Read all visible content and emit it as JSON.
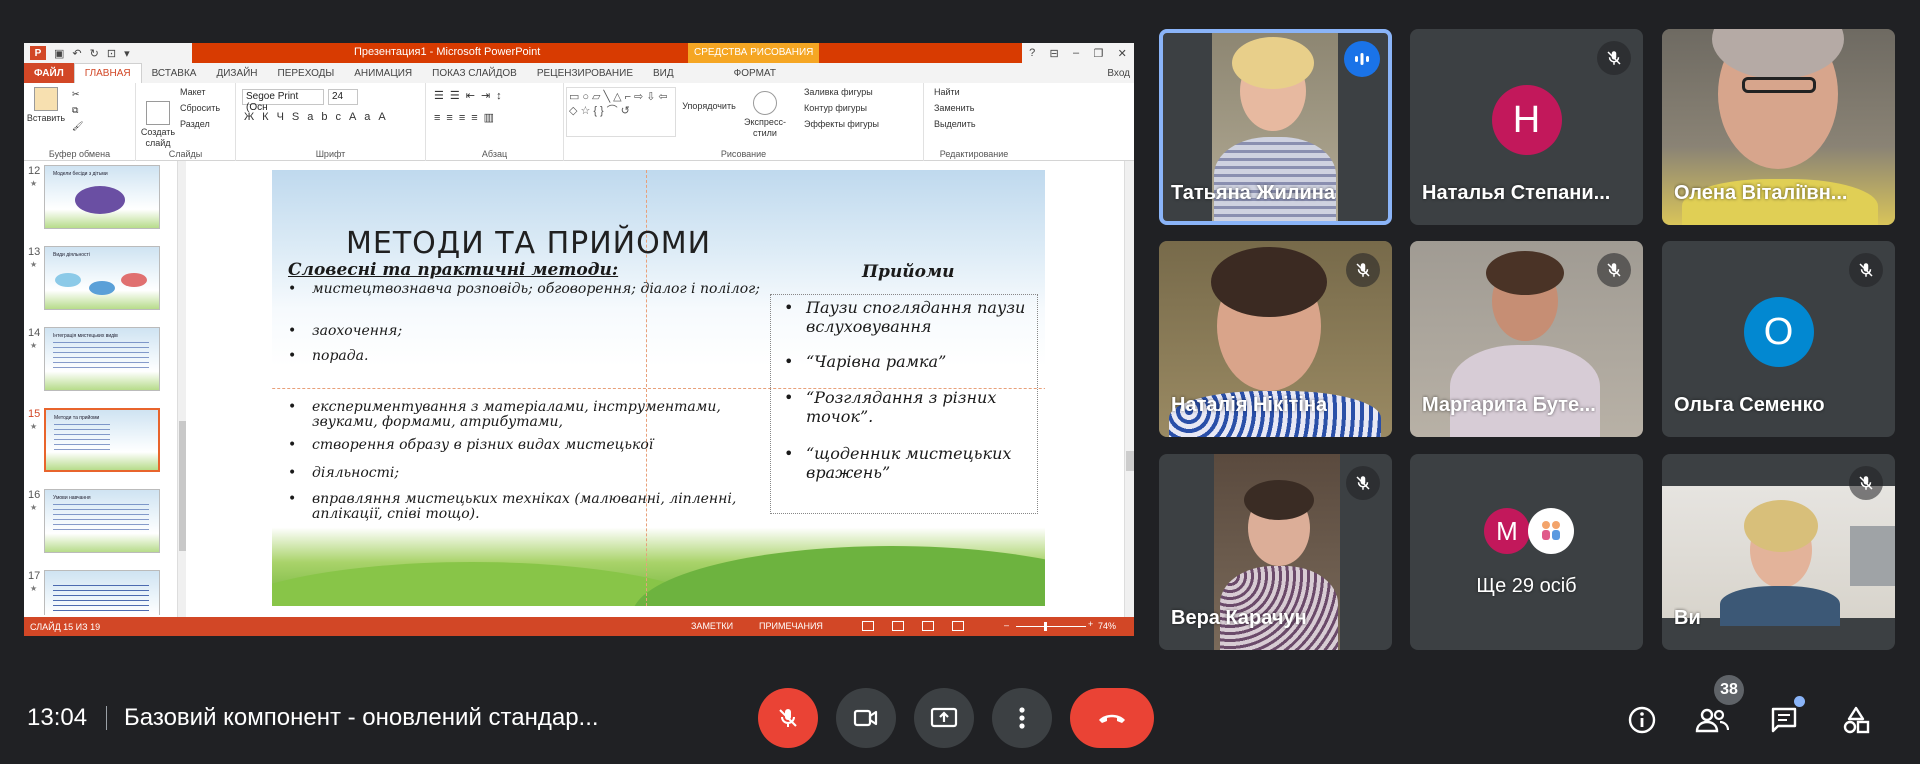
{
  "powerpoint": {
    "title": "Презентация1 - Microsoft PowerPoint",
    "context_tab": "СРЕДСТВА РИСОВАНИЯ",
    "tabs": [
      "ФАЙЛ",
      "ГЛАВНАЯ",
      "ВСТАВКА",
      "ДИЗАЙН",
      "ПЕРЕХОДЫ",
      "АНИМАЦИЯ",
      "ПОКАЗ СЛАЙДОВ",
      "РЕЦЕНЗИРОВАНИЕ",
      "ВИД",
      "ФОРМАТ"
    ],
    "signin": "Вход",
    "ribbon": {
      "paste": "Вставить",
      "clipboard_group": "Буфер обмена",
      "layout": "Макет",
      "reset": "Сбросить",
      "section": "Раздел",
      "new_slide": "Создать слайд",
      "slides_group": "Слайды",
      "font_name": "Segoe Print (Осн",
      "font_size": "24",
      "font_group": "Шрифт",
      "paragraph_group": "Абзац",
      "arrange": "Упорядочить",
      "quick_styles": "Экспресс-стили",
      "shape_fill": "Заливка фигуры",
      "shape_outline": "Контур фигуры",
      "shape_effects": "Эффекты фигуры",
      "drawing_group": "Рисование",
      "find": "Найти",
      "replace": "Заменить",
      "select": "Выделить",
      "editing_group": "Редактирование"
    },
    "thumbnails": [
      {
        "num": "12",
        "title": "Модели бесіди з дітьми"
      },
      {
        "num": "13",
        "title": "Види діяльності"
      },
      {
        "num": "14",
        "title": "Інтеграція мистецьких видів"
      },
      {
        "num": "15",
        "title": "Методи та прийоми"
      },
      {
        "num": "16",
        "title": "Умови навчання"
      },
      {
        "num": "17",
        "title": ""
      }
    ],
    "slide": {
      "title": "МЕТОДИ ТА ПРИЙОМИ",
      "subtitle": "Словесні та практичні методи:",
      "right_header": "Прийоми",
      "left_items": [
        "мистецтвознавча розповідь; обговорення; діалог і полілог;",
        "заохочення;",
        "порада.",
        "експериментування з матеріалами, інструментами, звуками, формами, атрибутами,",
        "створення образу в різних видах мистецької",
        "діяльності;",
        "вправляння мистецьких техніках (малюванні, ліпленні, аплікації, співі тощо)."
      ],
      "right_items": [
        "Паузи споглядання паузи вслуховування",
        "“Чарівна рамка”",
        "“Розглядання з різних точок”.",
        "“щоденник мистецьких вражень”"
      ]
    },
    "status": {
      "slide_count": "СЛАЙД 15 ИЗ 19",
      "notes": "ЗАМЕТКИ",
      "comments": "ПРИМЕЧАНИЯ",
      "zoom": "74%"
    }
  },
  "participants": [
    {
      "name": "Татьяна Жилина",
      "type": "video",
      "mic": "speaking"
    },
    {
      "name": "Наталья Степани...",
      "type": "avatar",
      "initial": "Н",
      "color": "#c2185b",
      "mic": "muted"
    },
    {
      "name": "Олена Віталіївн...",
      "type": "video",
      "mic": "none"
    },
    {
      "name": "Наталія Нікітіна",
      "type": "video",
      "mic": "muted"
    },
    {
      "name": "Маргарита Буте...",
      "type": "video",
      "mic": "muted"
    },
    {
      "name": "Ольга Семенко",
      "type": "avatar",
      "initial": "О",
      "color": "#0288d1",
      "mic": "muted"
    },
    {
      "name": "Вера Карачун",
      "type": "video",
      "mic": "muted"
    },
    {
      "name": "Ще 29 осіб",
      "type": "others",
      "initial": "М",
      "color": "#c2185b"
    },
    {
      "name": "Ви",
      "type": "video",
      "mic": "muted"
    }
  ],
  "meeting": {
    "time": "13:04",
    "title": "Базовий компонент - оновлений стандар...",
    "people_count": "38"
  },
  "colors": {
    "background": "#202124",
    "tile": "#3c4043",
    "end_call": "#ea4335",
    "accent": "#8ab4f8",
    "ppt_orange": "#d24726"
  }
}
